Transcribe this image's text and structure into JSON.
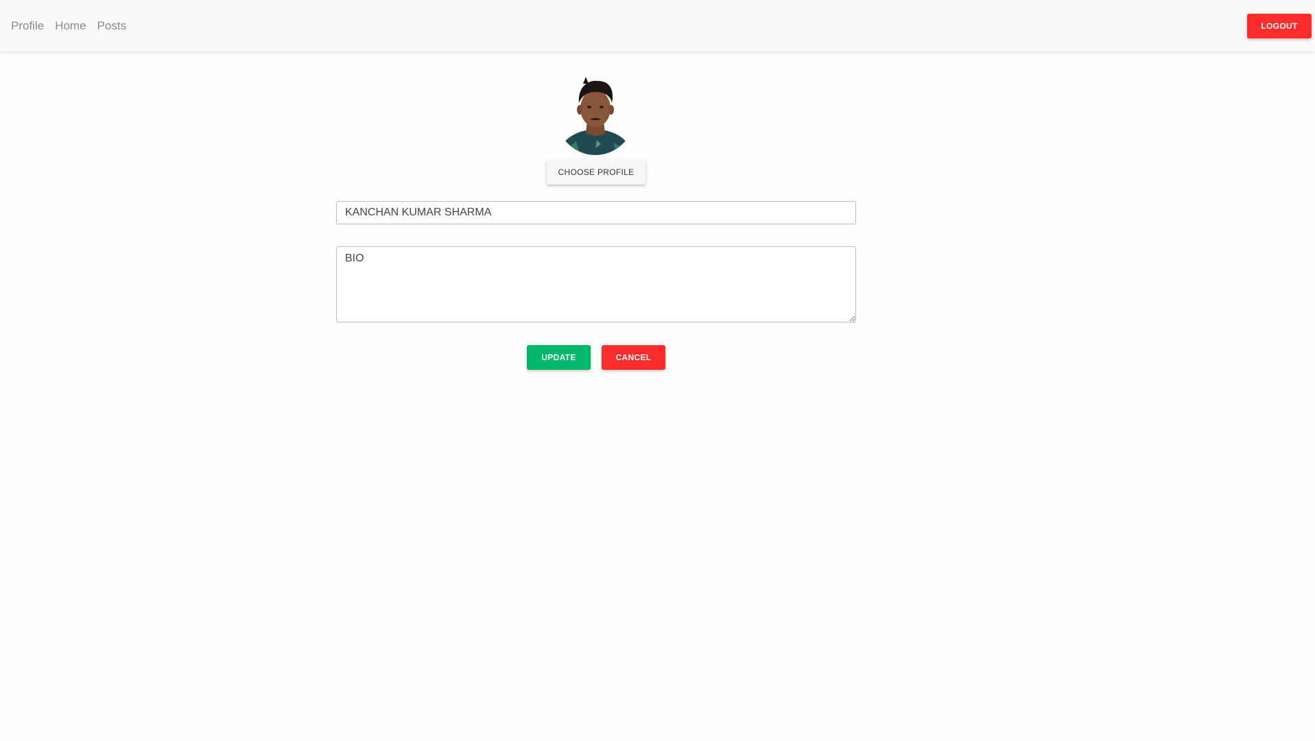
{
  "nav": {
    "links": [
      "Profile",
      "Home",
      "Posts"
    ],
    "logout_label": "LOGOUT"
  },
  "profile": {
    "choose_label": "CHOOSE PROFILE",
    "name_value": "KANCHAN KUMAR SHARMA",
    "bio_placeholder": "BIO",
    "bio_value": ""
  },
  "actions": {
    "update_label": "UPDATE",
    "cancel_label": "CANCEL"
  },
  "colors": {
    "navbar_bg": "#f9faf8",
    "logout": "#fc2c2c",
    "update": "#00b86b",
    "cancel": "#fc2c2c"
  }
}
